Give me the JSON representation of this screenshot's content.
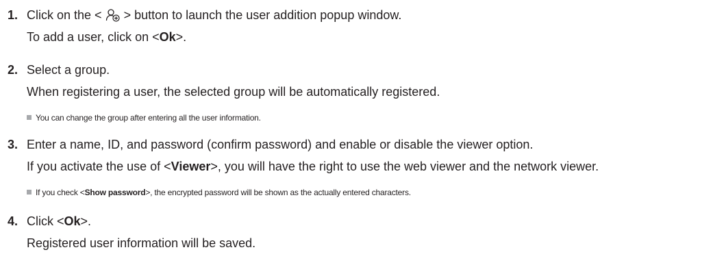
{
  "steps": [
    {
      "number": "1.",
      "line1": {
        "before_icon": "Click on the < ",
        "icon": "add-user-icon",
        "after_icon": " > button to launch the user addition popup window."
      },
      "line2": {
        "before": "To add a user, click on <",
        "bold": "Ok",
        "after": ">."
      }
    },
    {
      "number": "2.",
      "line1": "Select a group.",
      "line2": "When registering a user, the selected group will be automatically registered.",
      "note": "You can change the group after entering all the user information."
    },
    {
      "number": "3.",
      "line1": "Enter a name, ID, and password (confirm password) and enable or disable the viewer option.",
      "line2": {
        "before": "If you activate the use of <",
        "bold": "Viewer",
        "after": ">, you will have the right to use the web viewer and the network viewer."
      },
      "note": {
        "before": "If you check <",
        "bold": "Show password",
        "after": ">, the encrypted password will be shown as the actually entered characters."
      }
    },
    {
      "number": "4.",
      "line1": {
        "before": "Click <",
        "bold": "Ok",
        "after": ">."
      },
      "line2": "Registered user information will be saved."
    }
  ]
}
